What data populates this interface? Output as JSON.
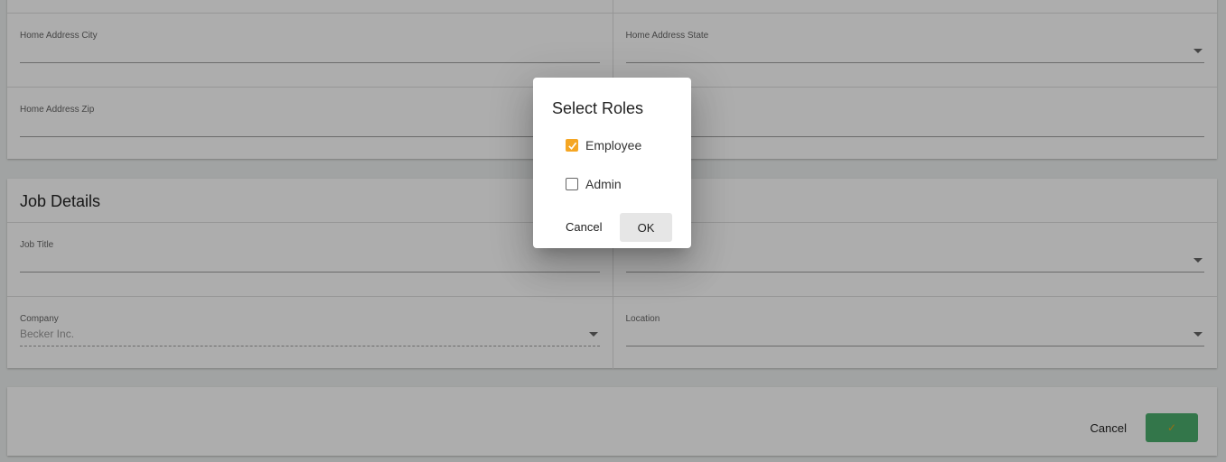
{
  "address_card": {
    "fields": {
      "city": {
        "label": "Home Address City"
      },
      "state": {
        "label": "Home Address State"
      },
      "zip": {
        "label": "Home Address Zip"
      }
    }
  },
  "job_details": {
    "title": "Job Details",
    "fields": {
      "job_title": {
        "label": "Job Title"
      },
      "company": {
        "label": "Company",
        "value": "Becker Inc."
      },
      "location": {
        "label": "Location"
      }
    }
  },
  "footer": {
    "cancel_label": "Cancel",
    "save_glyph": "✓"
  },
  "dialog": {
    "title": "Select Roles",
    "options": [
      {
        "label": "Employee",
        "checked": true
      },
      {
        "label": "Admin",
        "checked": false
      }
    ],
    "cancel_label": "Cancel",
    "ok_label": "OK"
  },
  "colors": {
    "accent": "#f5a623",
    "save_button": "#4caf6e"
  },
  "icons": [
    "chevron-down-icon",
    "checkmark-icon"
  ]
}
